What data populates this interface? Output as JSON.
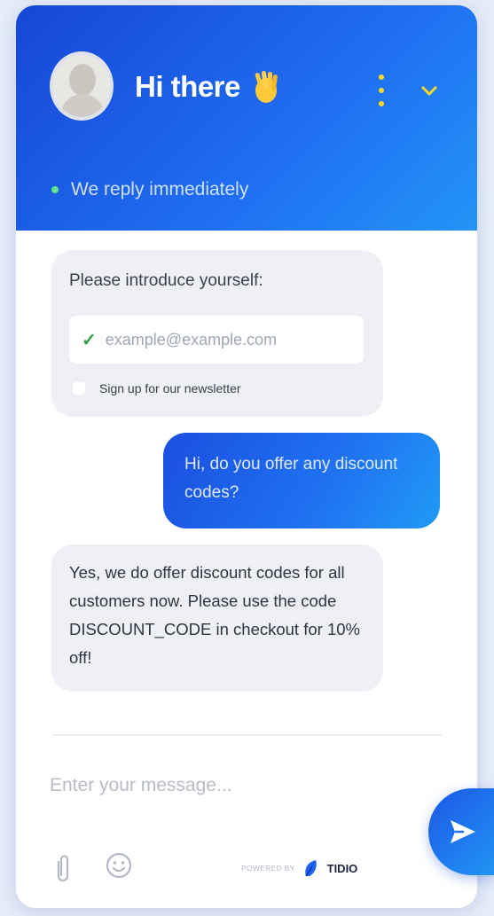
{
  "header": {
    "title": "Hi there",
    "status_text": "We reply immediately",
    "colors": {
      "gradient_start": "#1746d6",
      "gradient_end": "#2394f6",
      "status_dot": "#5ee28a"
    }
  },
  "form_card": {
    "title": "Please introduce yourself:",
    "email_placeholder": "example@example.com",
    "newsletter_label": "Sign up for our newsletter",
    "newsletter_checked": false
  },
  "messages": [
    {
      "sender": "visitor",
      "text": "Hi, do you offer any discount codes?"
    },
    {
      "sender": "operator",
      "text": "Yes, we do offer discount codes for all customers now. Please use the code DISCOUNT_CODE in checkout for 10% off!"
    }
  ],
  "composer": {
    "placeholder": "Enter your message..."
  },
  "footer": {
    "powered_by": "POWERED BY",
    "brand": "TIDIO"
  },
  "icons": [
    "avatar",
    "waving-hand-icon",
    "more-options-icon",
    "chevron-down-icon",
    "check-icon",
    "paperclip-icon",
    "emoji-icon",
    "tidio-logo-icon",
    "send-icon"
  ]
}
